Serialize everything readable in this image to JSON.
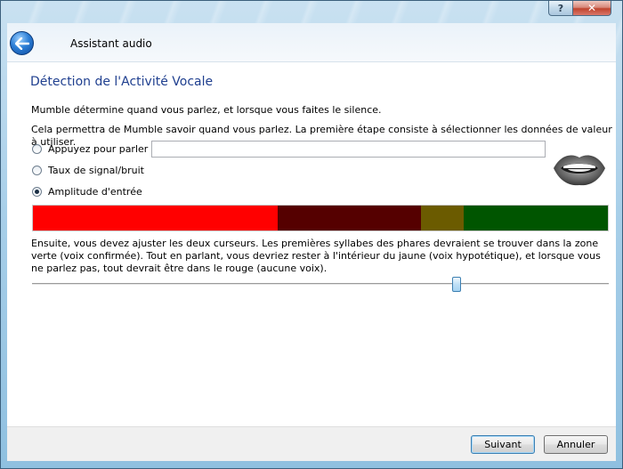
{
  "window": {
    "title": "Assistant audio",
    "help_glyph": "?",
    "close_glyph": "✕"
  },
  "page": {
    "title": "Détection de l'Activité Vocale",
    "intro": "Mumble détermine quand vous parlez, et lorsque vous faites le silence.",
    "intro2": "Cela permettra de Mumble savoir quand vous parlez. La première étape consiste à sélectionner les données de valeur à utiliser."
  },
  "options": [
    {
      "label": "Appuyez pour parler :",
      "checked": false
    },
    {
      "label": "Taux de signal/bruit",
      "checked": false
    },
    {
      "label": "Amplitude d'entrée",
      "checked": true
    }
  ],
  "shortcut_field": {
    "value": ""
  },
  "meter": {
    "colors": {
      "red": "#ff0000",
      "dark_red": "#550000",
      "olive": "#6b5b00",
      "green": "#005500"
    },
    "segments": [
      {
        "zone": "red",
        "fraction": 0.425
      },
      {
        "zone": "dark_red",
        "fraction": 0.25
      },
      {
        "zone": "olive",
        "fraction": 0.075
      },
      {
        "zone": "green",
        "fraction": 0.25
      }
    ]
  },
  "description": "Ensuite, vous devez ajuster les deux curseurs. Les premières syllabes des phares devraient se trouver dans la zone verte (voix confirmée). Tout en parlant, vous devriez rester à l'intérieur du jaune (voix hypotétique), et lorsque vous ne parlez pas, tout devrait être dans le rouge (aucune voix).",
  "slider": {
    "value_fraction": 0.74
  },
  "footer": {
    "next_label": "Suivant",
    "cancel_label": "Annuler"
  }
}
